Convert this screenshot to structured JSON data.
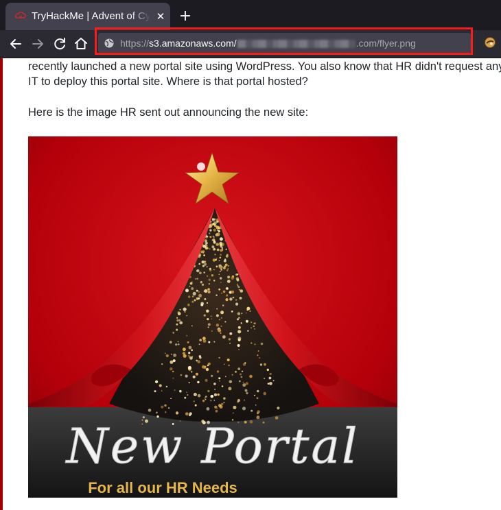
{
  "browser": {
    "tab": {
      "title": "TryHackMe | Advent of Cyber",
      "close_glyph": "✕",
      "favicon": "tryhackme-icon"
    },
    "new_tab_glyph": "+",
    "nav": {
      "back": "back-arrow-icon",
      "forward": "forward-arrow-icon",
      "reload": "reload-icon",
      "home": "home-icon"
    },
    "url": {
      "prefix": "https://",
      "host": "s3.amazonaws.com/",
      "suffix": ".com/flyer.png",
      "icon": "globe-icon"
    },
    "extension_icon": "extension-icon"
  },
  "page": {
    "paragraph_lines": [
      "recently launched a new portal site using WordPress. You also know that HR didn't request any i",
      "IT to deploy this portal site. Where is that portal hosted?"
    ],
    "intro": "Here is the image HR sent out announcing the new site:"
  },
  "flyer": {
    "title": "New Portal",
    "subtitle": "For all our HR Needs"
  },
  "colors": {
    "highlight": "#ff1a1a",
    "accent_rule": "#a30000",
    "flyer_red": "#c1000b",
    "flyer_gold": "#e6b64a"
  }
}
